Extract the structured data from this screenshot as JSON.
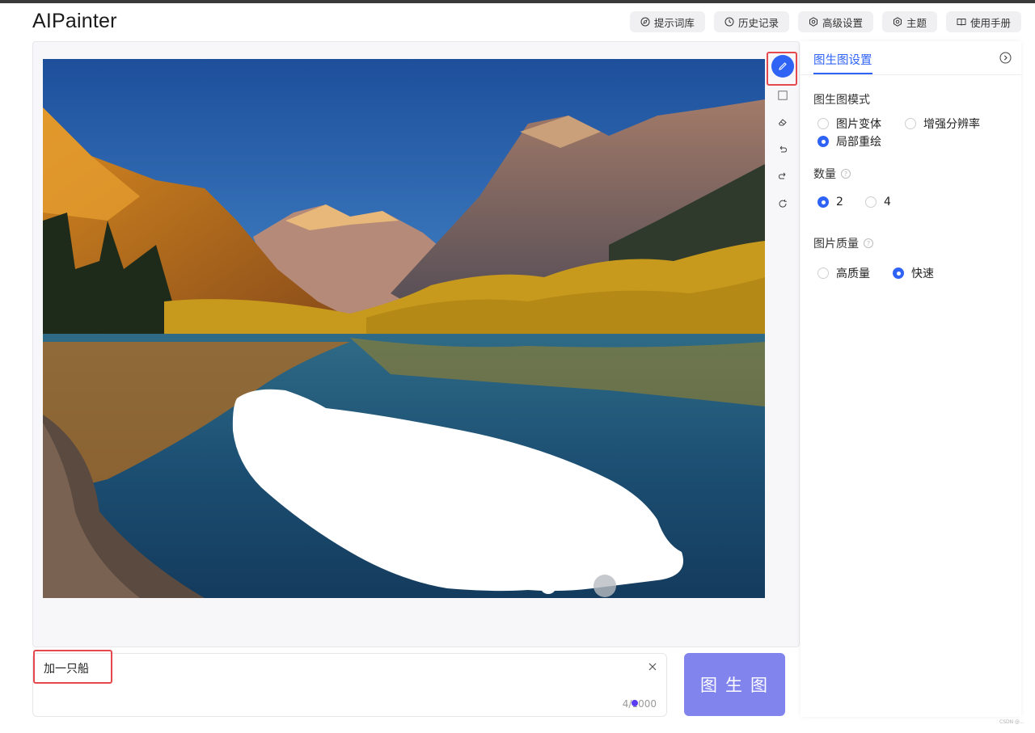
{
  "app": {
    "title": "AIPainter"
  },
  "nav": [
    {
      "label": "提示词库",
      "icon": "compass-icon"
    },
    {
      "label": "历史记录",
      "icon": "history-icon"
    },
    {
      "label": "高级设置",
      "icon": "gear-icon"
    },
    {
      "label": "主题",
      "icon": "gear-icon"
    },
    {
      "label": "使用手册",
      "icon": "book-icon"
    }
  ],
  "canvas": {
    "image": "mountain lake landscape at dawn with a white painted mask over the water",
    "tools": [
      "pencil-icon",
      "rectangle-icon",
      "eraser-icon",
      "undo-icon",
      "redo-icon",
      "reset-icon"
    ],
    "active_tool": "pencil-icon"
  },
  "settings": {
    "tab": "图生图设置",
    "mode": {
      "title": "图生图模式",
      "options": [
        "图片变体",
        "增强分辨率",
        "局部重绘"
      ],
      "selected": "局部重绘"
    },
    "count": {
      "title": "数量",
      "options": [
        "2",
        "4"
      ],
      "selected": "2"
    },
    "quality": {
      "title": "图片质量",
      "options": [
        "高质量",
        "快速"
      ],
      "selected": "快速"
    }
  },
  "prompt": {
    "value": "加一只船",
    "counter": "4/1000"
  },
  "generate": {
    "label": "图生图"
  },
  "footer": {
    "watermark": "CSDN @..."
  },
  "colors": {
    "accent": "#2f63f5",
    "generate_button": "#8284ee",
    "highlight": "#e5484d"
  }
}
